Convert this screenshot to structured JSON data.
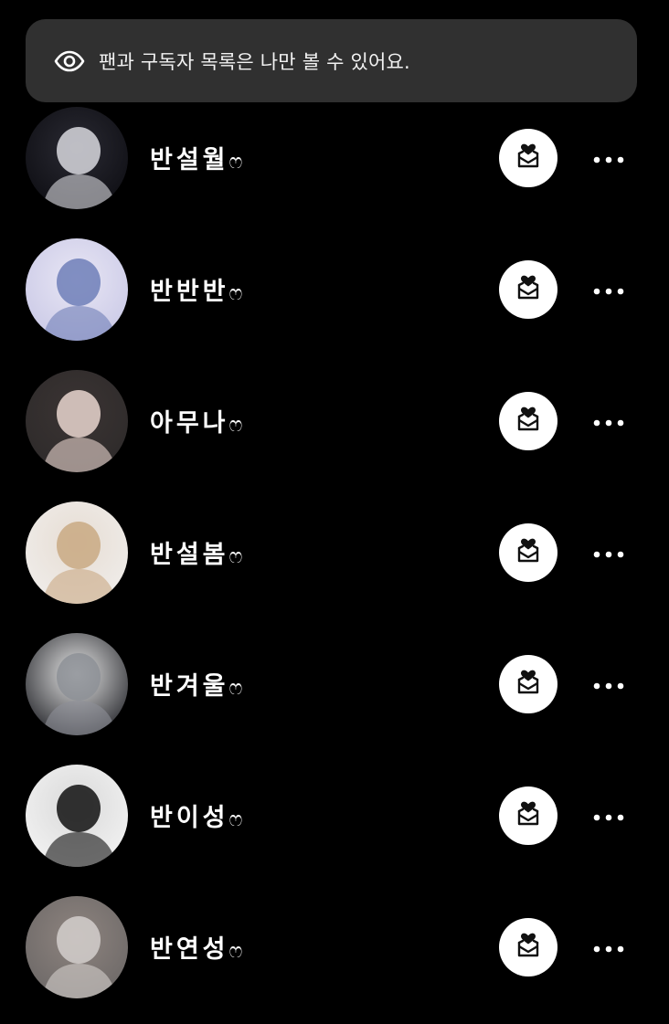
{
  "notice": {
    "icon": "eye-icon",
    "text": "팬과 구독자 목록은 나만 볼 수 있어요."
  },
  "users": [
    {
      "name": "반설월",
      "suffix": "ෆ",
      "avatar_colors": [
        "#0d0d12",
        "#d8d8de",
        "#2a2a33"
      ]
    },
    {
      "name": "반반반",
      "suffix": "ෆ",
      "avatar_colors": [
        "#c9c8e6",
        "#6f7fb8",
        "#e8e6f4"
      ]
    },
    {
      "name": "아무나",
      "suffix": "ෆ",
      "avatar_colors": [
        "#2d2a2a",
        "#e9d6cf",
        "#3b3433"
      ]
    },
    {
      "name": "반설봄",
      "suffix": "ෆ",
      "avatar_colors": [
        "#f0eeec",
        "#c9a983",
        "#e7ddd3"
      ]
    },
    {
      "name": "반겨울",
      "suffix": "ෆ",
      "avatar_colors": [
        "#1e1f24",
        "#8d9097",
        "#e6e6e6"
      ]
    },
    {
      "name": "반이성",
      "suffix": "ෆ",
      "avatar_colors": [
        "#f4f4f4",
        "#111111",
        "#d9d9d9"
      ]
    },
    {
      "name": "반연성",
      "suffix": "ෆ",
      "avatar_colors": [
        "#6b6766",
        "#d4cfcc",
        "#8e847f"
      ]
    }
  ],
  "icons": {
    "message": "heart-mail-icon",
    "more": "more-dots-icon"
  }
}
